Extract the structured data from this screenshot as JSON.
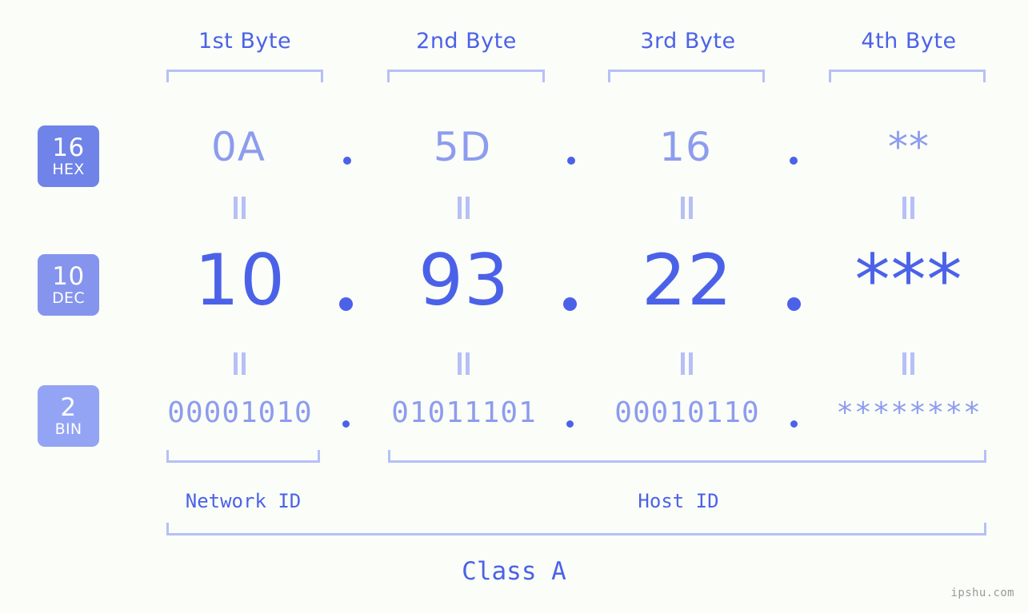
{
  "meta": {
    "watermark": "ipshu.com",
    "accent_dark": "#4b62e8",
    "accent_mid": "#8d9cee",
    "accent_light": "#b6c0f6",
    "background": "#fbfdf8"
  },
  "columns": [
    {
      "header": "1st Byte"
    },
    {
      "header": "2nd Byte"
    },
    {
      "header": "3rd Byte"
    },
    {
      "header": "4th Byte"
    }
  ],
  "bases": [
    {
      "num": "16",
      "abbr": "HEX",
      "color": "#7083e8"
    },
    {
      "num": "10",
      "abbr": "DEC",
      "color": "#8594ec"
    },
    {
      "num": "2",
      "abbr": "BIN",
      "color": "#93a4f4"
    }
  ],
  "rows": {
    "hex": {
      "values": [
        "0A",
        "5D",
        "16",
        "**"
      ]
    },
    "dec": {
      "values": [
        "10",
        "93",
        "22",
        "***"
      ]
    },
    "bin": {
      "values": [
        "00001010",
        "01011101",
        "00010110",
        "********"
      ]
    }
  },
  "separator": ".",
  "equals_mark": "‖",
  "segments": {
    "network_id": "Network ID",
    "host_id": "Host ID",
    "class": "Class A"
  }
}
